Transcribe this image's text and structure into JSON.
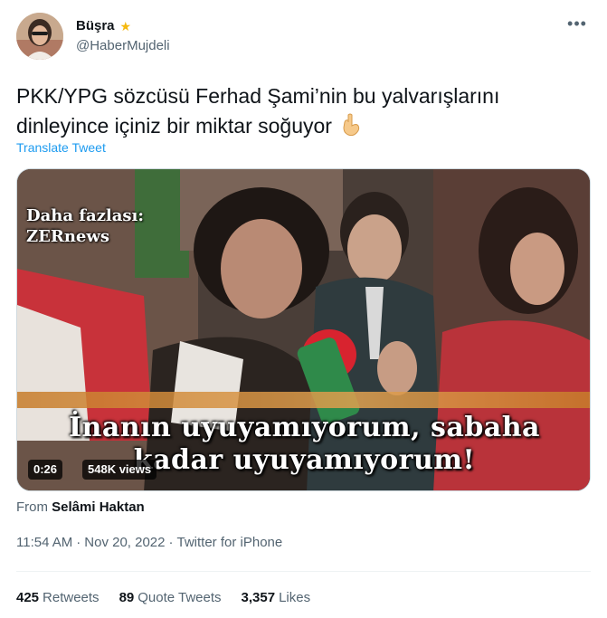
{
  "author": {
    "display_name": "Büşra",
    "handle": "@HaberMujdeli"
  },
  "icons": {
    "badge": "shooting-star-emoji-icon",
    "more": "more-options-icon",
    "hand": "backhand-index-pointing-down-emoji-icon"
  },
  "tweet": {
    "text": "PKK/YPG sözcüsü Ferhad Şami’nin bu yalvarışlarını dinleyince içiniz bir miktar soğuyor",
    "translate_label": "Translate Tweet"
  },
  "media": {
    "watermark_line1": "Daha fazlası:",
    "watermark_line2": "ZERnews",
    "subtitle_line1": "İnanın uyuyamıyorum, sabaha",
    "subtitle_line2": "kadar uyuyamıyorum!",
    "duration": "0:26",
    "views": "548K views"
  },
  "attribution": {
    "prefix": "From",
    "author": "Selâmi Haktan"
  },
  "meta": {
    "time": "11:54 AM",
    "date": "Nov 20, 2022",
    "source": "Twitter for iPhone"
  },
  "stats": {
    "retweets_count": "425",
    "retweets_label": "Retweets",
    "quotes_count": "89",
    "quotes_label": "Quote Tweets",
    "likes_count": "3,357",
    "likes_label": "Likes"
  },
  "colors": {
    "link": "#1d9bf0",
    "secondary_text": "#536471",
    "primary_text": "#0f1419"
  }
}
